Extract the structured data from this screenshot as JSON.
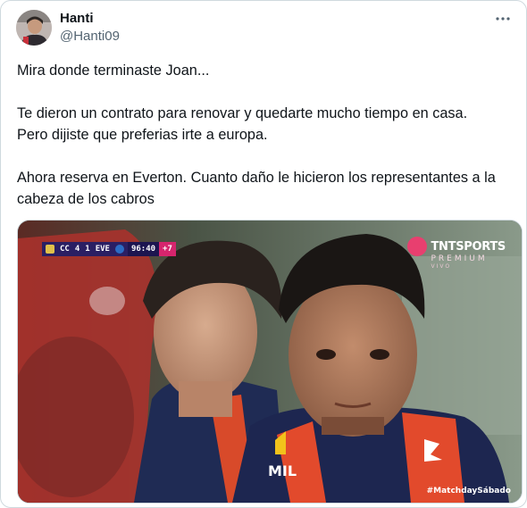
{
  "tweet": {
    "author_name": "Hanti",
    "author_handle": "@Hanti09",
    "more_icon": "more-horizontal-icon",
    "text": "Mira donde terminaste Joan...\n\nTe dieron un contrato para renovar y quedarte mucho tiempo en casa.\nPero dijiste que preferias irte a europa.\n\nAhora reserva en Everton. Cuanto daño le hicieron los representantes a la cabeza de los cabros"
  },
  "media": {
    "scorebug": {
      "home": "CC",
      "home_score": "4",
      "away_score": "1",
      "away": "EVE",
      "clock": "96:40",
      "added_time": "+7"
    },
    "broadcaster": {
      "title": "TNTSPORTS",
      "subtitle": "PREMIUM",
      "tag": "VIVO"
    },
    "hashtag": "#MatchdaySábado",
    "shirt_sponsor": "MIL"
  },
  "colors": {
    "text": "#0f1419",
    "secondary": "#536471",
    "border": "#cfd9de",
    "scorebug_bg": "#2a1f63",
    "accent_pink": "#d6256d"
  }
}
